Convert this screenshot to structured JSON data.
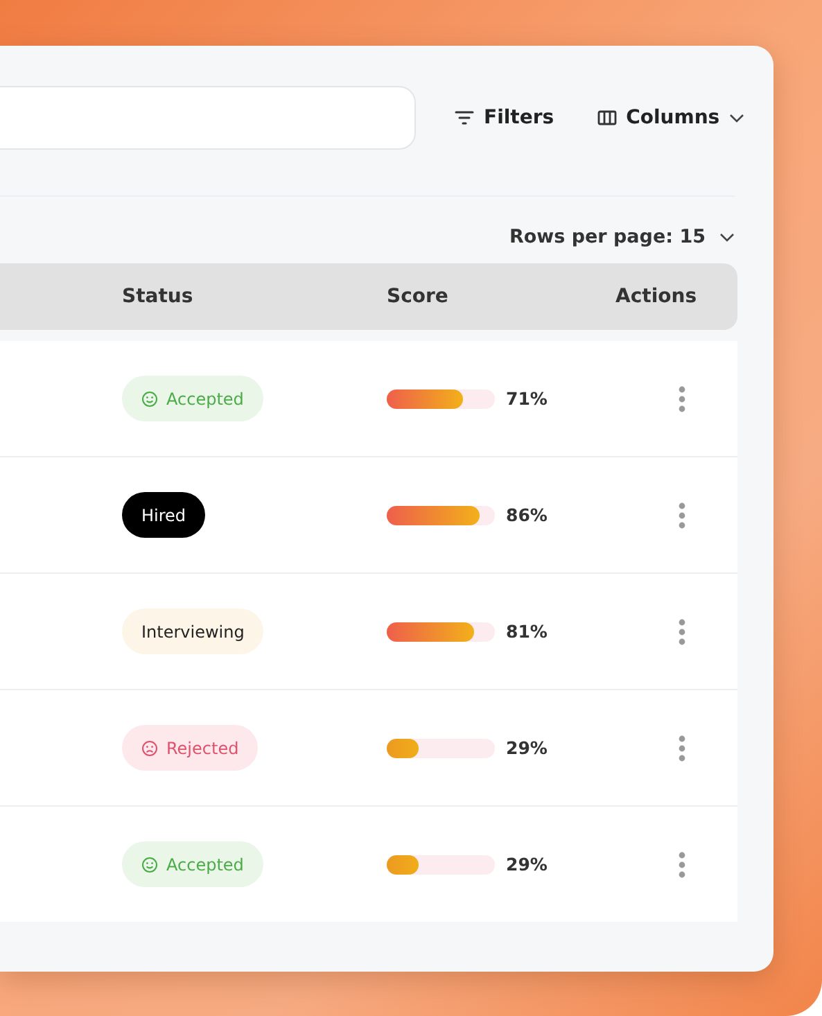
{
  "toolbar": {
    "filters": "Filters",
    "columns": "Columns"
  },
  "pagination": {
    "label": "Rows per page:",
    "value": "15"
  },
  "table": {
    "columns": [
      "Status",
      "Score",
      "Actions"
    ],
    "rows": [
      {
        "status": {
          "label": "Accepted",
          "kind": "accepted"
        },
        "score": {
          "level": 0.71,
          "reading": "71%"
        }
      },
      {
        "status": {
          "label": "Hired",
          "kind": "hired"
        },
        "score": {
          "level": 0.86,
          "reading": "86%"
        }
      },
      {
        "status": {
          "label": "Interviewing",
          "kind": "interviewing"
        },
        "score": {
          "level": 0.81,
          "reading": "81%"
        }
      },
      {
        "status": {
          "label": "Rejected",
          "kind": "rejected"
        },
        "score": {
          "level": 0.29,
          "reading": "29%"
        }
      },
      {
        "status": {
          "label": "Accepted",
          "kind": "accepted"
        },
        "score": {
          "level": 0.29,
          "reading": "29%"
        }
      }
    ]
  }
}
